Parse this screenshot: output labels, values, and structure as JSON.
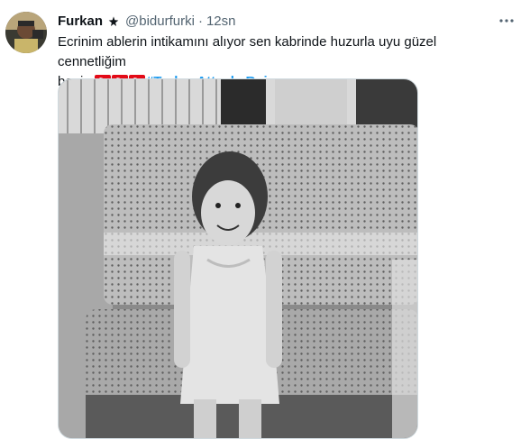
{
  "tweet": {
    "display_name": "Furkan",
    "handle": "@bidurfurki",
    "separator": "·",
    "time": "12sn",
    "text_line1": "Ecrinim ablerin intikamını alıyor sen kabrinde huzurla uyu güzel cennetliğim",
    "text_line2_prefix": "benim",
    "hashtag": "#TurkeyAttacksRojava",
    "flags": [
      "tr-flag",
      "tr-flag",
      "tr-flag"
    ],
    "media_icon": "photo-of-child-on-bench"
  },
  "icons": {
    "verified": "verified-badge-icon",
    "more": "more-options-icon"
  },
  "colors": {
    "accent": "#1d9bf0",
    "secondary_text": "#536471",
    "primary_text": "#0f1419",
    "flag_red": "#e30a17"
  }
}
